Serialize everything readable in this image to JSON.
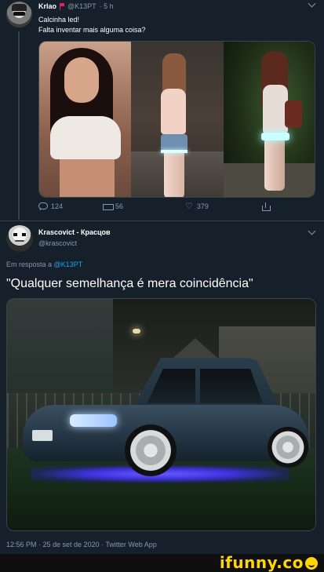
{
  "tweet1": {
    "name": "Krlao",
    "handle": "@K13PT",
    "time": "· 5 h",
    "line1": "Calcinha led!",
    "line2": "Falta inventar mais alguma coisa?",
    "actions": {
      "replies": "124",
      "retweets": "56",
      "likes": "379"
    }
  },
  "tweet2": {
    "name": "Krascovict - Красцов",
    "handle": "@krascovict",
    "reply_prefix": "Em resposta a",
    "reply_target": "@K13PT",
    "text": "\"Qualquer semelhança é mera coincidência\"",
    "timestamp": "12:56 PM · 25 de set de 2020 · Twitter Web App"
  },
  "watermark": {
    "text": "ifunny.co"
  },
  "colors": {
    "background": "#15202b",
    "muted": "#8899a6",
    "link": "#1da1f2",
    "flag": "#e0245e",
    "watermark": "#ffd600"
  },
  "icons": [
    "reply-icon",
    "retweet-icon",
    "heart-icon",
    "share-icon",
    "caret-down-icon",
    "flag-icon",
    "smiley-icon"
  ]
}
